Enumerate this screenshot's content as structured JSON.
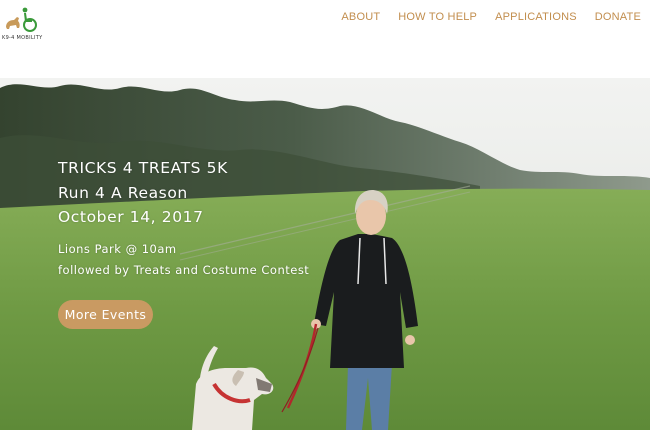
{
  "brand": {
    "logo_text": "K9-4 MOBILITY"
  },
  "nav": {
    "items": [
      {
        "label": "ABOUT"
      },
      {
        "label": "HOW TO HELP"
      },
      {
        "label": "APPLICATIONS"
      },
      {
        "label": "DONATE"
      }
    ]
  },
  "hero": {
    "line1": "TRICKS 4 TREATS 5K",
    "line2": "Run 4 A Reason",
    "line3": "October 14, 2017",
    "sub1": "Lions Park @ 10am",
    "sub2": "followed by Treats and Costume Contest",
    "button_label": "More Events"
  },
  "colors": {
    "nav_text": "#c28e4e",
    "button_bg": "#c99a62",
    "grass": "#6e9a44",
    "logo_green": "#3a9a3a",
    "logo_tan": "#c89a5a"
  }
}
